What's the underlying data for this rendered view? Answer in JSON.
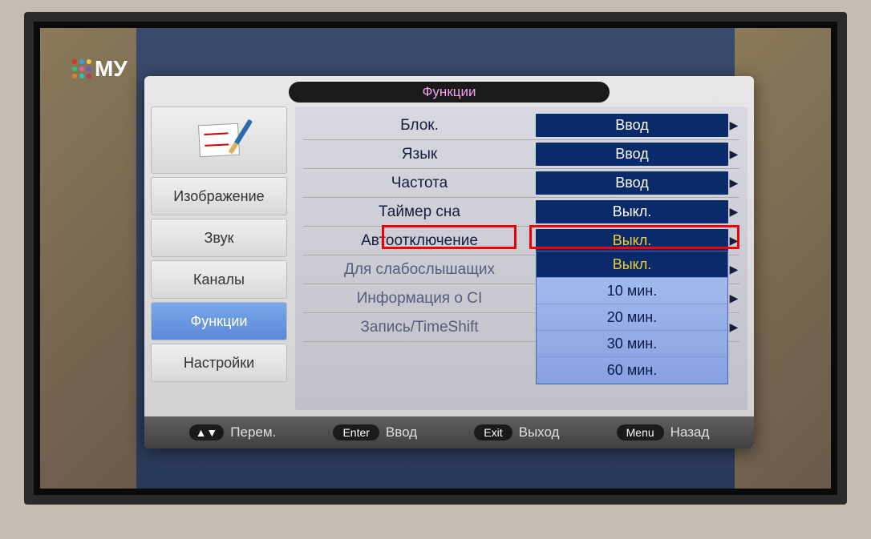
{
  "channel_logo": "МУ",
  "osd": {
    "title": "Функции",
    "sidebar": {
      "items": [
        {
          "label": "Изображение",
          "active": false
        },
        {
          "label": "Звук",
          "active": false
        },
        {
          "label": "Каналы",
          "active": false
        },
        {
          "label": "Функции",
          "active": true
        },
        {
          "label": "Настройки",
          "active": false
        }
      ]
    },
    "settings": [
      {
        "label": "Блок.",
        "value": "Ввод"
      },
      {
        "label": "Язык",
        "value": "Ввод"
      },
      {
        "label": "Частота",
        "value": "Ввод"
      },
      {
        "label": "Таймер сна",
        "value": "Выкл."
      },
      {
        "label": "Автоотключение",
        "value": "Выкл.",
        "highlighted": true
      },
      {
        "label": "Для слабослышащих",
        "value": ""
      },
      {
        "label": "Информация о CI",
        "value": ""
      },
      {
        "label": "Запись/TimeShift",
        "value": ""
      }
    ],
    "dropdown": {
      "options": [
        {
          "label": "Выкл.",
          "selected": true
        },
        {
          "label": "10 мин.",
          "selected": false
        },
        {
          "label": "20 мин.",
          "selected": false
        },
        {
          "label": "30 мин.",
          "selected": false
        },
        {
          "label": "60 мин.",
          "selected": false
        }
      ]
    },
    "footer": {
      "nav_icon": "▲▼",
      "nav_label": "Перем.",
      "enter_badge": "Enter",
      "enter_label": "Ввод",
      "exit_badge": "Exit",
      "exit_label": "Выход",
      "menu_badge": "Menu",
      "menu_label": "Назад"
    }
  }
}
